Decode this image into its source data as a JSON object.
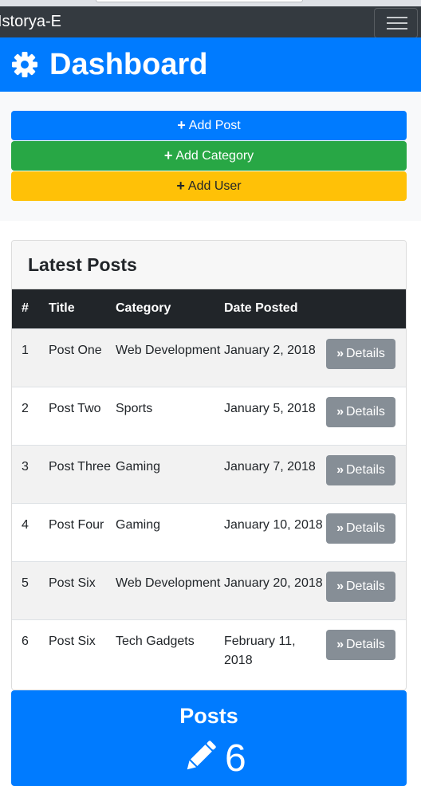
{
  "navbar": {
    "brand": "Istorya-E"
  },
  "header": {
    "title": "Dashboard",
    "icon": "gear-icon"
  },
  "actions": [
    {
      "label": "Add Post",
      "color": "#007bff"
    },
    {
      "label": "Add Category",
      "color": "#28a745"
    },
    {
      "label": "Add User",
      "color": "#ffc107"
    }
  ],
  "latest_posts": {
    "title": "Latest Posts",
    "columns": [
      "#",
      "Title",
      "Category",
      "Date Posted"
    ],
    "details_label": "Details",
    "rows": [
      {
        "num": "1",
        "title": "Post One",
        "category": "Web Development",
        "date": "January 2, 2018"
      },
      {
        "num": "2",
        "title": "Post Two",
        "category": "Sports",
        "date": "January 5, 2018"
      },
      {
        "num": "3",
        "title": "Post Three",
        "category": "Gaming",
        "date": "January 7, 2018"
      },
      {
        "num": "4",
        "title": "Post Four",
        "category": "Gaming",
        "date": "January 10, 2018"
      },
      {
        "num": "5",
        "title": "Post Six",
        "category": "Web Development",
        "date": "January 20, 2018"
      },
      {
        "num": "6",
        "title": "Post Six",
        "category": "Tech Gadgets",
        "date": "February 11, 2018"
      }
    ]
  },
  "stats": {
    "title": "Posts",
    "count": "6",
    "icon": "pencil-icon"
  }
}
